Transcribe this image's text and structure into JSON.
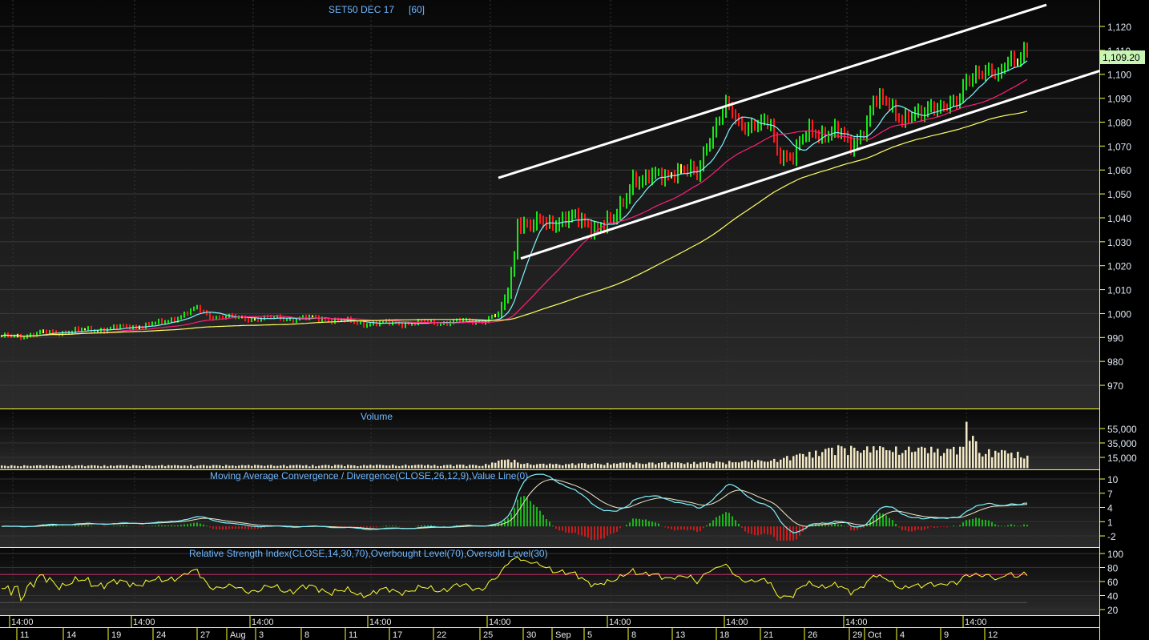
{
  "chart_data": {
    "type": "candlestick",
    "title": "SET50 DEC 17",
    "interval": "[60]",
    "last_price_label": "1,109.20",
    "last_price": 1109.2,
    "price_axis": {
      "ticks": [
        "1,120",
        "1,110",
        "1,100",
        "1,090",
        "1,080",
        "1,070",
        "1,060",
        "1,050",
        "1,040",
        "1,030",
        "1,020",
        "1,010",
        "1,000",
        "990",
        "980",
        "970"
      ],
      "ylim": [
        966,
        1131
      ]
    },
    "close_waypoints": [
      [
        0,
        990
      ],
      [
        15,
        992
      ],
      [
        37,
        994
      ],
      [
        50,
        996
      ],
      [
        61,
        1002
      ],
      [
        65,
        999
      ],
      [
        75,
        998
      ],
      [
        100,
        998
      ],
      [
        112,
        996
      ],
      [
        130,
        996
      ],
      [
        150,
        997
      ],
      [
        156,
        1000
      ],
      [
        158,
        1010
      ],
      [
        160,
        1025
      ],
      [
        161,
        1040
      ],
      [
        165,
        1036
      ],
      [
        175,
        1040
      ],
      [
        185,
        1037
      ],
      [
        191,
        1038
      ],
      [
        195,
        1050
      ],
      [
        197,
        1058
      ],
      [
        200,
        1055
      ],
      [
        210,
        1060
      ],
      [
        217,
        1058
      ],
      [
        220,
        1072
      ],
      [
        226,
        1086
      ],
      [
        230,
        1080
      ],
      [
        240,
        1078
      ],
      [
        242,
        1068
      ],
      [
        247,
        1066
      ],
      [
        252,
        1076
      ],
      [
        260,
        1076
      ],
      [
        265,
        1070
      ],
      [
        270,
        1080
      ],
      [
        272,
        1088
      ],
      [
        277,
        1088
      ],
      [
        281,
        1082
      ],
      [
        287,
        1082
      ],
      [
        290,
        1088
      ],
      [
        298,
        1086
      ],
      [
        301,
        1098
      ],
      [
        304,
        1102
      ],
      [
        308,
        1100
      ],
      [
        311,
        1098
      ],
      [
        314,
        1108
      ],
      [
        317,
        1107
      ],
      [
        320,
        1109.2
      ]
    ],
    "volume_waypoints": [
      [
        0,
        4000
      ],
      [
        150,
        5000
      ],
      [
        158,
        14000
      ],
      [
        165,
        6000
      ],
      [
        195,
        8000
      ],
      [
        220,
        9000
      ],
      [
        240,
        12000
      ],
      [
        250,
        22000
      ],
      [
        260,
        32000
      ],
      [
        280,
        30000
      ],
      [
        300,
        30000
      ],
      [
        301,
        70000
      ],
      [
        305,
        28000
      ],
      [
        320,
        22000
      ]
    ],
    "moving_averages": [
      {
        "period": 10,
        "color": "#7ff4ff"
      },
      {
        "period": 30,
        "color": "#ff1f7a"
      },
      {
        "period": 90,
        "color": "#ffff66"
      }
    ],
    "channel_lines": [
      {
        "from": [
          155,
          1056.7
        ],
        "to": [
          326,
          1129
        ]
      },
      {
        "from": [
          162,
          1023
        ],
        "to": [
          343,
          1101.6
        ]
      }
    ],
    "volume_panel": {
      "title": "Volume",
      "ticks": [
        "55,000",
        "35,000",
        "15,000"
      ]
    },
    "macd_panel": {
      "title": "Moving Average Convergence / Divergence(CLOSE,26,12,9),Value Line(0)",
      "ticks": [
        "10",
        "7",
        "4",
        "1",
        "-2"
      ],
      "ylim": [
        -2,
        10
      ]
    },
    "rsi_panel": {
      "title": "Relative Strength Index(CLOSE,14,30,70),Overbought Level(70),Oversold Level(30)",
      "ticks": [
        "100",
        "80",
        "60",
        "40",
        "20"
      ],
      "overbought": 70,
      "oversold": 30
    },
    "time_axis": {
      "hours": [
        "14:00",
        "14:00",
        "14:00",
        "14:00",
        "14:00",
        "14:00",
        "14:00",
        "14:00",
        "14:00"
      ],
      "dates": [
        "11",
        "14",
        "19",
        "24",
        "27",
        "Aug",
        "3",
        "8",
        "11",
        "17",
        "22",
        "25",
        "30",
        "Sep",
        "5",
        "8",
        "13",
        "18",
        "21",
        "26",
        "29",
        "Oct",
        "4",
        "9",
        "12"
      ]
    },
    "colors": {
      "up": "#19e619",
      "down": "#ff1a1a",
      "neutral": "#ffff33",
      "axis": "#ffff33",
      "title": "#6fb8ff",
      "volume": "#f3e9c6",
      "macd": "#7ff4ff",
      "signal": "#f3e9c6",
      "rsi": "#ffff33"
    }
  }
}
